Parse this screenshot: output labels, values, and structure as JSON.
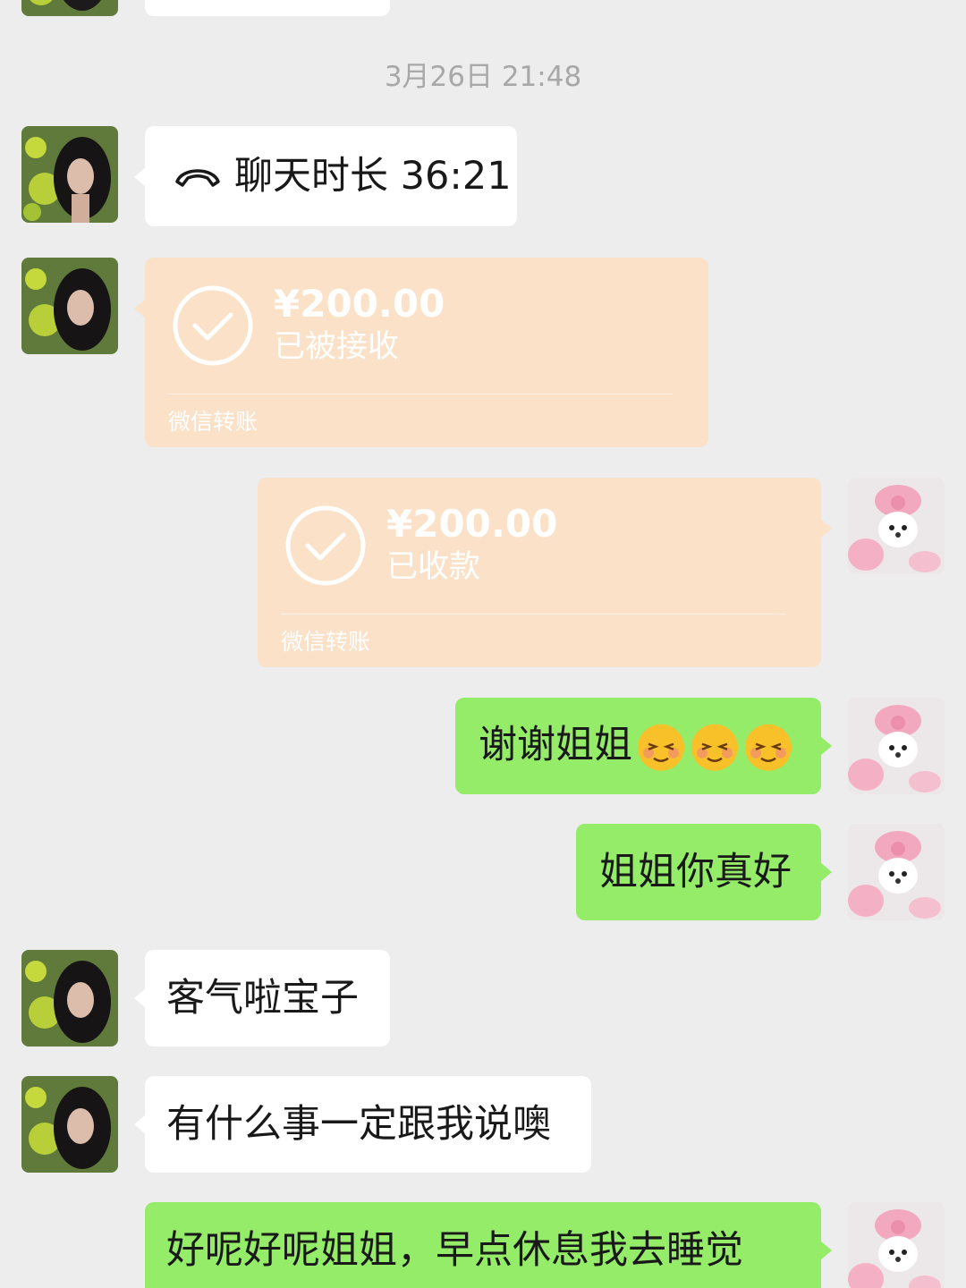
{
  "timestamp": "3月26日 21:48",
  "messages": {
    "call": {
      "label": "聊天时长 36:21"
    },
    "transfer_in": {
      "amount": "¥200.00",
      "status": "已被接收",
      "footer": "微信转账"
    },
    "transfer_out": {
      "amount": "¥200.00",
      "status": "已收款",
      "footer": "微信转账"
    },
    "thanks": {
      "text": "谢谢姐姐",
      "emoji": [
        "shy-face-icon",
        "shy-face-icon",
        "shy-face-icon"
      ]
    },
    "nice": {
      "text": "姐姐你真好"
    },
    "welcome": {
      "text": "客气啦宝子"
    },
    "tell_me": {
      "text": "有什么事一定跟我说噢"
    },
    "goodnight": {
      "text": "好呢好呢姐姐，早点休息我去睡觉"
    }
  },
  "colors": {
    "background": "#ededed",
    "bubble_self": "#95ec69",
    "bubble_other": "#ffffff",
    "transfer_card": "#fbe1c7",
    "timestamp_text": "#a8a8a8"
  }
}
